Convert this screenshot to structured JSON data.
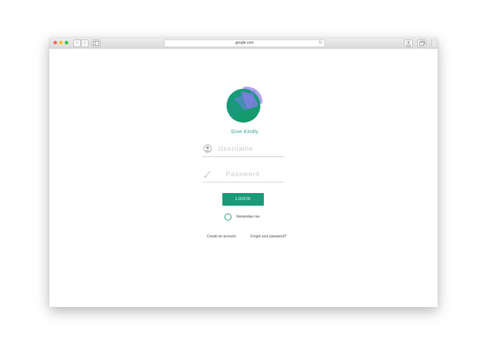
{
  "browser": {
    "address": "google.com",
    "nav_back": "‹",
    "nav_forward": "›",
    "reload": "↻"
  },
  "brand": {
    "name": "Give.Kindly",
    "primary_color": "#1a9a77",
    "secondary_color": "#8f7ee6"
  },
  "form": {
    "username_placeholder": "Username",
    "password_placeholder": "Password",
    "login_label": "LOGIN",
    "remember_label": "Remember me",
    "create_account_label": "Create an account",
    "forgot_password_label": "Forgot your password?"
  },
  "icons": {
    "username": "user-circle-icon",
    "password": "key-icon"
  }
}
